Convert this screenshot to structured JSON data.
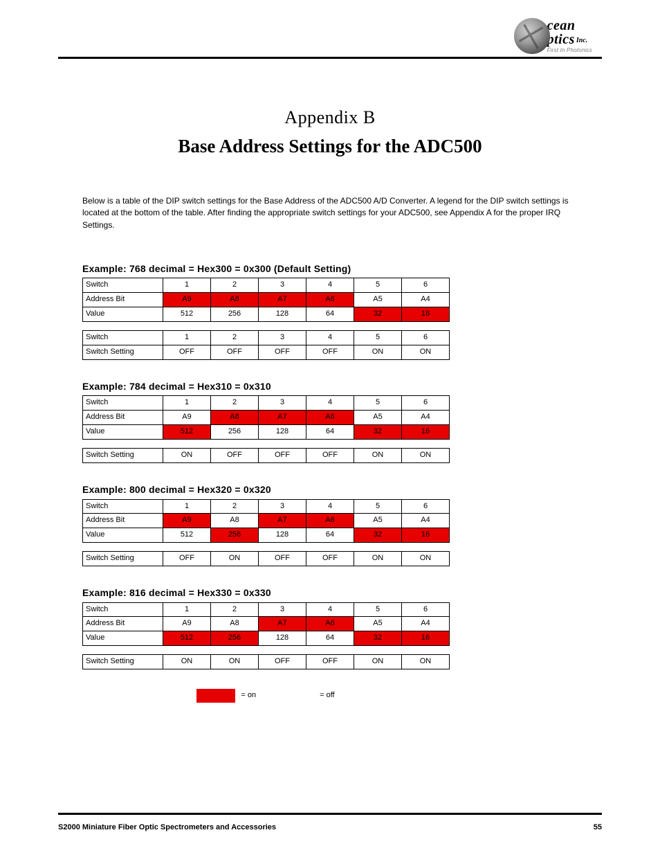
{
  "logo": {
    "line1": "cean",
    "line2": "ptics",
    "inc": "Inc.",
    "tagline": "First In Photonics"
  },
  "appendix_label": "Appendix B",
  "page_title": "Base Address Settings for the ADC500",
  "intro": "Below is a table of the DIP switch settings for the Base Address of the ADC500 A/D Converter. A legend for the DIP switch settings is located at the bottom of the table. After finding the appropriate switch settings for your ADC500, see Appendix A for the proper IRQ Settings.",
  "columns": [
    "",
    "1",
    "2",
    "3",
    "4",
    "5",
    "6"
  ],
  "row_labels": {
    "switch": "Switch",
    "address_bit": "Address Bit",
    "value": "Value",
    "switch_setting": "Switch Setting"
  },
  "address_bits": [
    "A9",
    "A8",
    "A7",
    "A6",
    "A5",
    "A4"
  ],
  "values": [
    "512",
    "256",
    "128",
    "64",
    "32",
    "16"
  ],
  "examples": [
    {
      "title": "Example: 768 decimal = Hex300 = 0x300 (Default Setting)",
      "addr_on": [
        true,
        true,
        true,
        true,
        false,
        false
      ],
      "value_on": [
        false,
        false,
        false,
        false,
        true,
        true
      ],
      "setting": [
        "OFF",
        "OFF",
        "OFF",
        "OFF",
        "ON",
        "ON"
      ]
    },
    {
      "title": "Example: 784 decimal = Hex310 = 0x310",
      "addr_on": [
        false,
        true,
        true,
        true,
        false,
        false
      ],
      "value_on": [
        true,
        false,
        false,
        false,
        true,
        true
      ],
      "setting": [
        "ON",
        "OFF",
        "OFF",
        "OFF",
        "ON",
        "ON"
      ]
    },
    {
      "title": "Example: 800 decimal = Hex320 = 0x320",
      "addr_on": [
        true,
        false,
        true,
        true,
        false,
        false
      ],
      "value_on": [
        false,
        true,
        false,
        false,
        true,
        true
      ],
      "setting": [
        "OFF",
        "ON",
        "OFF",
        "OFF",
        "ON",
        "ON"
      ]
    },
    {
      "title": "Example: 816 decimal = Hex330 = 0x330",
      "addr_on": [
        false,
        false,
        true,
        true,
        false,
        false
      ],
      "value_on": [
        true,
        true,
        false,
        false,
        true,
        true
      ],
      "setting": [
        "ON",
        "ON",
        "OFF",
        "OFF",
        "ON",
        "ON"
      ]
    }
  ],
  "legend": {
    "on": "= on",
    "off": "= off"
  },
  "footer": {
    "left": "S2000 Miniature Fiber Optic Spectrometers and Accessories",
    "right": "55"
  }
}
